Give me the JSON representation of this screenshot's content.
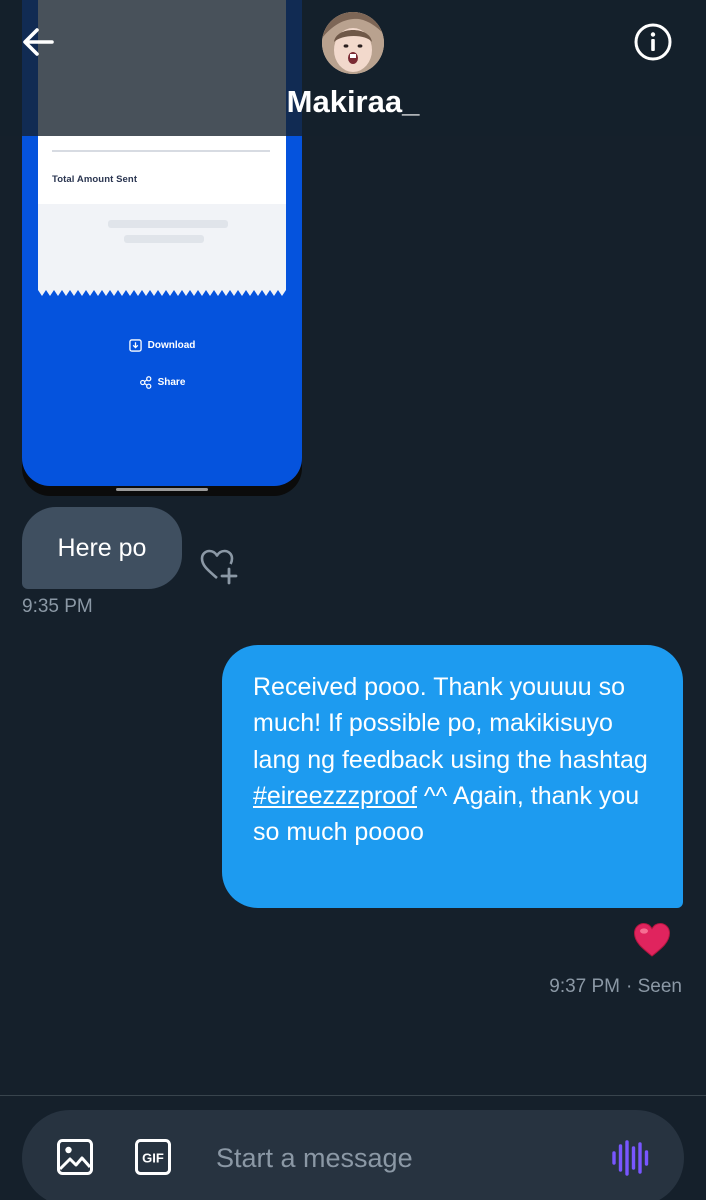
{
  "header": {
    "contact_name": "Makiraa_",
    "back_icon": "arrow-left-icon",
    "info_icon": "info-icon"
  },
  "attachment": {
    "receipt_label": "Total Amount Sent",
    "download_label": "Download",
    "share_label": "Share",
    "blue_color": "#0553dd"
  },
  "messages": [
    {
      "direction": "incoming",
      "text": "Here po",
      "time": "9:35 PM"
    },
    {
      "direction": "outgoing",
      "text_before": "Received pooo. Thank youuuu so much! If possible po, makikisuyo lang ng feedback using the hashtag ",
      "hashtag": "#eireezzzproof",
      "text_after": " ^^ Again, thank you so much poooo",
      "reaction": "❤️",
      "time": "9:37 PM",
      "status": "· Seen"
    }
  ],
  "composer": {
    "placeholder": "Start a message",
    "gif_label": "GIF"
  },
  "colors": {
    "background": "#15202b",
    "incoming_bubble": "#3f4f60",
    "outgoing_bubble": "#1d9bf0",
    "muted_text": "#8b98a5",
    "voice_accent": "#7856ff"
  }
}
